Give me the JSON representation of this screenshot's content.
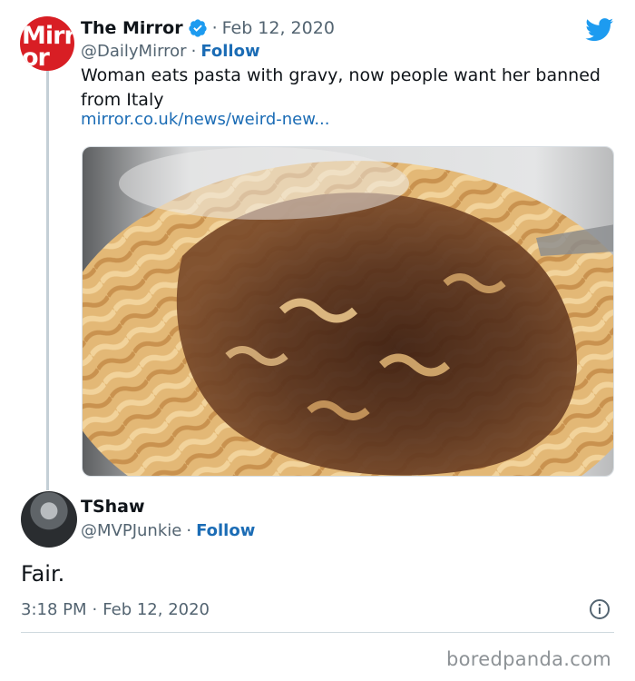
{
  "quoted_tweet": {
    "display_name": "The Mirror",
    "verified": true,
    "separator": "·",
    "date": "Feb 12, 2020",
    "handle": "@DailyMirror",
    "follow_label": "Follow",
    "text": "Woman eats pasta with gravy, now people want her banned from Italy",
    "link": "mirror.co.uk/news/weird-new...",
    "avatar_text_line1": "Mirr",
    "avatar_text_line2": "or",
    "media": "photo of fusilli pasta covered in brown gravy on a white plate"
  },
  "reply_tweet": {
    "display_name": "TShaw",
    "handle": "@MVPJunkie",
    "separator": "·",
    "follow_label": "Follow",
    "text": "Fair.",
    "time": "3:18 PM",
    "date": "Feb 12, 2020"
  },
  "icons": {
    "platform": "twitter-bird-icon",
    "verified": "verified-badge-icon",
    "info": "info-icon"
  },
  "colors": {
    "link": "#1b6cb5",
    "muted": "#536471",
    "twitter_blue": "#1d9bf0",
    "mirror_red": "#d81e24"
  },
  "watermark": "boredpanda.com"
}
